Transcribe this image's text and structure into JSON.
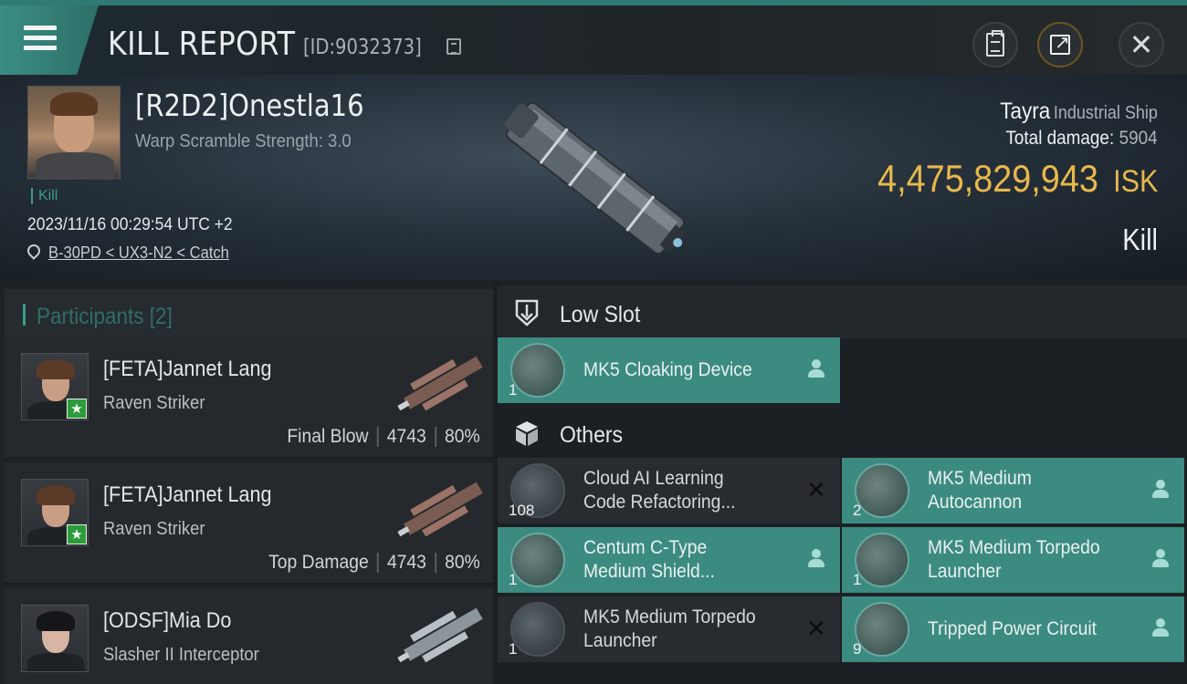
{
  "header": {
    "title": "KILL REPORT",
    "report_id": "[ID:9032373]",
    "menu_icon": "hamburger-icon",
    "buttons": [
      "clipboard-icon",
      "share-icon",
      "close-icon"
    ]
  },
  "victim": {
    "name": "[R2D2]Onestla16",
    "warp_scramble": "Warp Scramble Strength: 3.0",
    "tag": "Kill",
    "time": "2023/11/16 00:29:54 UTC +2",
    "location": "B-30PD < UX3-N2 < Catch",
    "ship_name": "Tayra",
    "ship_class": "Industrial Ship",
    "total_damage_label": "Total damage:",
    "total_damage": "5904",
    "isk_value": "4,475,829,943",
    "isk_unit": "ISK",
    "result": "Kill"
  },
  "participants": {
    "title": "Participants [2]",
    "items": [
      {
        "name": "[FETA]Jannet Lang",
        "ship": "Raven Striker",
        "role": "Final Blow",
        "damage": "4743",
        "percent": "80%",
        "starred": true
      },
      {
        "name": "[FETA]Jannet Lang",
        "ship": "Raven Striker",
        "role": "Top Damage",
        "damage": "4743",
        "percent": "80%",
        "starred": true
      },
      {
        "name": "[ODSF]Mia Do",
        "ship": "Slasher II Interceptor",
        "role": "",
        "damage": "",
        "percent": "",
        "starred": false
      }
    ]
  },
  "loadout": {
    "low_slot": {
      "label": "Low Slot",
      "icon": "low-slot-icon",
      "items": [
        {
          "name": "MK5 Cloaking Device",
          "qty": "1",
          "state": "fitted"
        }
      ]
    },
    "others": {
      "label": "Others",
      "icon": "cube-icon",
      "items": [
        {
          "name": "Cloud AI Learning\nCode Refactoring...",
          "qty": "108",
          "state": "destroyed"
        },
        {
          "name": "MK5 Medium\nAutocannon",
          "qty": "2",
          "state": "fitted"
        },
        {
          "name": "Centum C-Type\nMedium Shield...",
          "qty": "1",
          "state": "fitted"
        },
        {
          "name": "MK5 Medium Torpedo\n Launcher",
          "qty": "1",
          "state": "fitted"
        },
        {
          "name": "MK5 Medium Torpedo\n Launcher",
          "qty": "1",
          "state": "destroyed"
        },
        {
          "name": "Tripped Power Circuit",
          "qty": "9",
          "state": "fitted"
        }
      ]
    }
  },
  "colors": {
    "accent_teal": "#3c8b81",
    "isk_gold": "#e8b84d",
    "panel": "#25292e"
  }
}
